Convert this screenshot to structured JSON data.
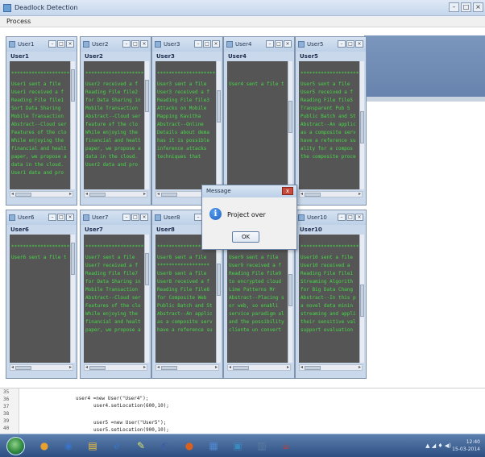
{
  "window": {
    "title": "Deadlock Detection"
  },
  "menu": {
    "process": "Process"
  },
  "users_top": [
    {
      "title": "User1",
      "label": "User1",
      "stars": "******************************",
      "lines": [
        "User1 sent a file",
        "User1 received a f",
        "Reading File file1",
        "Sort Data Sharing",
        "Mobile Transaction",
        "Abstract--Cloud ser",
        "Features of the clo",
        "While enjoying the",
        "financial and healt",
        "paper, we propose a",
        "data in the cloud.",
        "User1 data and pro"
      ]
    },
    {
      "title": "User2",
      "label": "User2",
      "stars": "******************************",
      "lines": [
        "User2 received a f",
        "Reading File file2",
        "for Data Sharing in",
        "Mobile Transaction",
        "Abstract--Cloud ser",
        "feature of the clo",
        "While enjoying the",
        "financial and healt",
        "paper, we propose a",
        "data in the cloud.",
        "User2 data and pro"
      ]
    },
    {
      "title": "User3",
      "label": "User3",
      "stars": "******************************",
      "lines": [
        "User3 sent a file",
        "User3 received a f",
        "Reading File file3",
        "Attacks on Mobile",
        "Mapping Kavitha",
        "Abstract--Online",
        "Details about dema",
        "has it is possible",
        "inference attacks",
        "techniques that"
      ]
    },
    {
      "title": "User4",
      "label": "User4",
      "stars": "",
      "lines": [
        "User4 sent a file t"
      ]
    },
    {
      "title": "User5",
      "label": "User5",
      "stars": "******************************",
      "lines": [
        "User5 sent a file",
        "User5 received a f",
        "Reading File file5",
        "Transparent Pub S",
        "Public Batch and St",
        "Abstract--An applic",
        "as a composite serv",
        "have a reference su",
        "ality for a compos",
        "the composite proce"
      ]
    }
  ],
  "users_bottom": [
    {
      "title": "User6",
      "label": "User6",
      "stars": "******************************",
      "lines": [
        "User6 sent a file t"
      ]
    },
    {
      "title": "User7",
      "label": "User7",
      "stars": "******************************",
      "lines": [
        "User7 sent a file",
        "User7 received a f",
        "Reading File file7",
        "for Data Sharing in",
        "Mobile Transaction",
        "Abstract--Cloud ser",
        "Features of the clo",
        "While enjoying the",
        "financial and healt",
        "paper, we propose a"
      ]
    },
    {
      "title": "User8",
      "label": "User8",
      "stars": "******************************",
      "lines": [
        "User8 sent a file",
        "******************",
        "User8 sent a file",
        "User8 received a f",
        "Reading File file8",
        "for Composite Web",
        "Public Batch and St",
        "Abstract--An applic",
        "as a composite serv",
        "have a reference su"
      ]
    },
    {
      "title": "User9",
      "label": "User9",
      "stars": "******************************",
      "lines": [
        "User9 sent a file",
        "User9 received a f",
        "Reading File file9",
        "to encrypted cloud",
        "Lime Patterns Mr",
        "Abstract--Placing s",
        "or web, so enabli",
        "service paradigm al",
        "and the possibility",
        "cliente un convert"
      ]
    },
    {
      "title": "User10",
      "label": "User10",
      "stars": "******************************",
      "lines": [
        "User10 sent a file",
        "User10 received a",
        "Reading File file1",
        "Streaming Algorith",
        "for Big Data Chang",
        "Abstract--In this p",
        "a novel data minin",
        "streaming and appli",
        "their sensitive val",
        "support evaluation"
      ]
    }
  ],
  "dialog": {
    "title": "Message",
    "text": "Project over",
    "ok": "OK",
    "close": "x"
  },
  "editor": {
    "line_numbers": [
      "35",
      "36",
      "37",
      "38",
      "39",
      "40"
    ],
    "code_lines": [
      "user4 =new User(\"User4\");",
      "user4.setLocation(600,10);",
      "user5 =new User(\"User5\");",
      "user5.setLocation(900,10);"
    ]
  },
  "taskbar": {
    "time": "12:40",
    "date": "15-03-2014",
    "apps": [
      "ie-icon",
      "media-player-icon",
      "folder-icon",
      "ie-icon",
      "notes-icon",
      "eclipse-icon",
      "firefox-icon",
      "paint-icon",
      "vmware-icon",
      "calculator-icon",
      "java-icon"
    ]
  }
}
